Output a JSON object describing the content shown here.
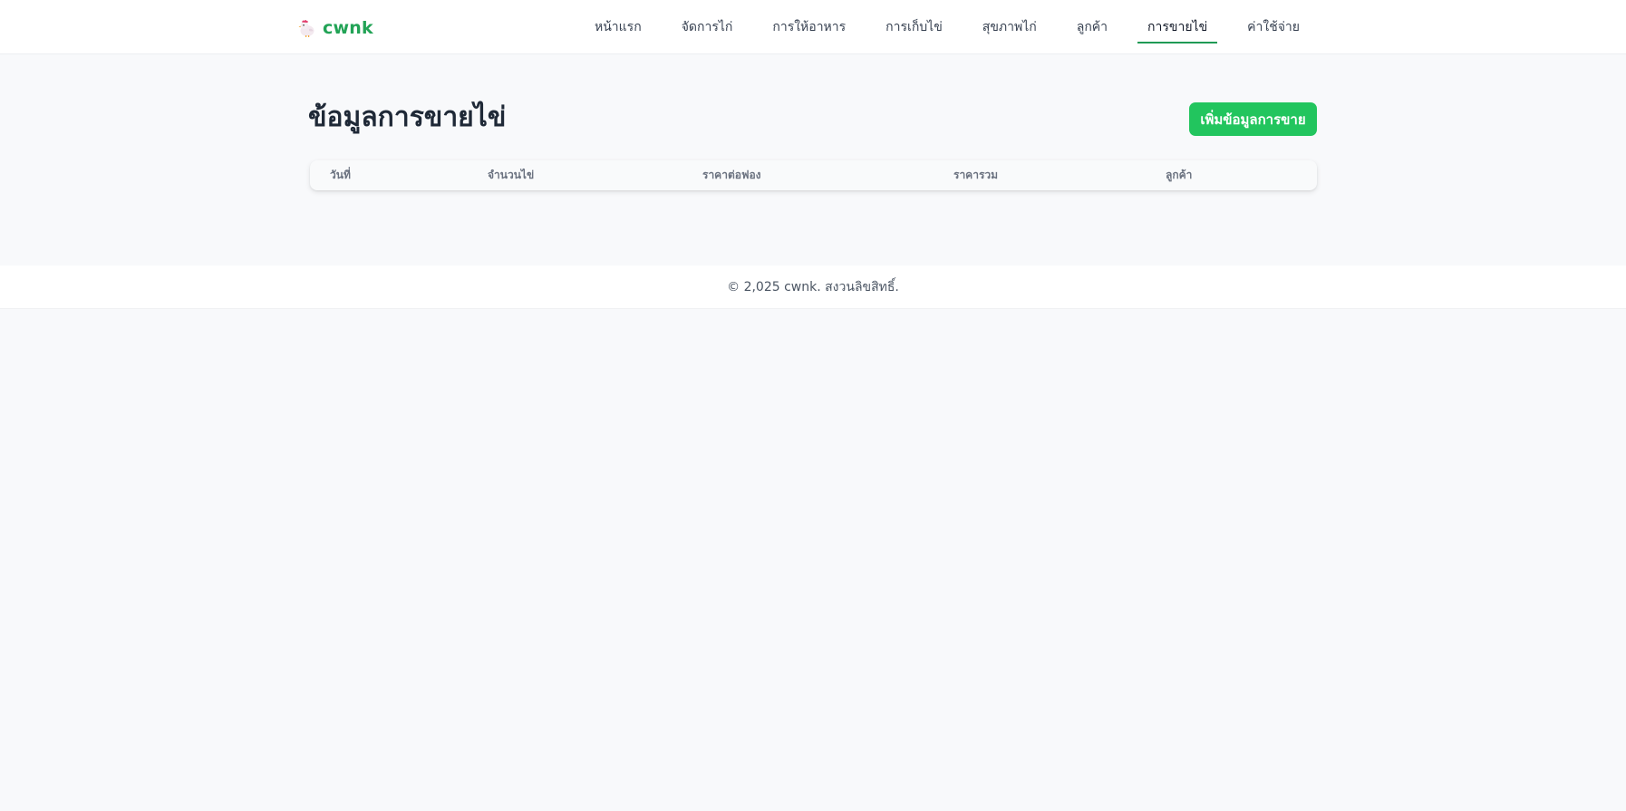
{
  "brand": {
    "name": "cwnk",
    "logo_icon": "chicken-icon"
  },
  "nav": {
    "items": [
      {
        "label": "หน้าแรก",
        "active": false
      },
      {
        "label": "จัดการไก่",
        "active": false
      },
      {
        "label": "การให้อาหาร",
        "active": false
      },
      {
        "label": "การเก็บไข่",
        "active": false
      },
      {
        "label": "สุขภาพไก่",
        "active": false
      },
      {
        "label": "ลูกค้า",
        "active": false
      },
      {
        "label": "การขายไข่",
        "active": true
      },
      {
        "label": "ค่าใช้จ่าย",
        "active": false
      }
    ]
  },
  "main": {
    "title": "ข้อมูลการขายไข่",
    "add_button_label": "เพิ่มข้อมูลการขาย",
    "table": {
      "columns": [
        "วันที่",
        "จำนวนไข่",
        "ราคาต่อฟอง",
        "ราคารวม",
        "ลูกค้า"
      ],
      "rows": []
    }
  },
  "footer": {
    "text": "© 2,025 cwnk. สงวนลิขสิทธิ์."
  },
  "colors": {
    "accent": "#22c55e",
    "brand": "#22a356",
    "active_underline": "#1f9a55",
    "background": "#f8f9fb"
  }
}
